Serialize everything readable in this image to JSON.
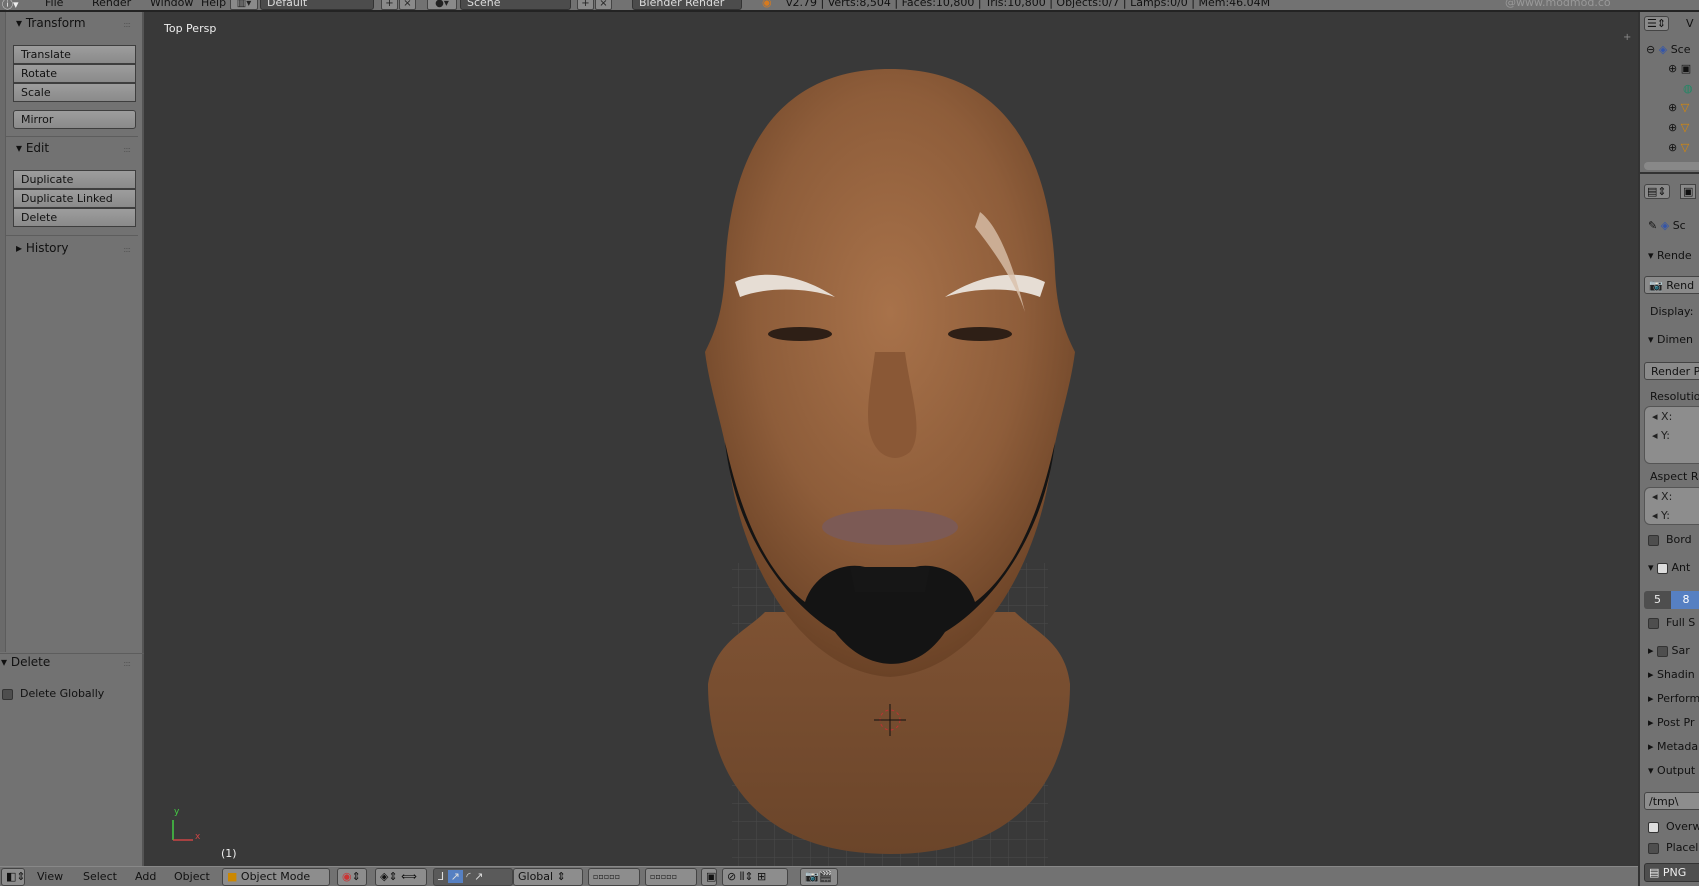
{
  "topbar": {
    "menus": [
      "File",
      "Render",
      "Window",
      "Help"
    ],
    "layout": "Default",
    "scene": "Scene",
    "engine": "Blender Render",
    "stats": "v2.79 | Verts:8,504 | Faces:10,800 | Tris:10,800 | Objects:0/7 | Lamps:0/0 | Mem:46.04M",
    "watermark": "@www.modmod.co"
  },
  "tools": {
    "transform": {
      "title": "Transform",
      "buttons": [
        "Translate",
        "Rotate",
        "Scale",
        "Mirror"
      ]
    },
    "edit": {
      "title": "Edit",
      "buttons": [
        "Duplicate",
        "Duplicate Linked",
        "Delete"
      ]
    },
    "history": {
      "title": "History"
    },
    "operator": {
      "title": "Delete",
      "option": "Delete Globally"
    }
  },
  "viewport": {
    "view_label": "Top Persp",
    "frame": "(1)",
    "axis_x": "x",
    "axis_y": "y"
  },
  "outliner": {
    "header": "V",
    "scene": "Sce"
  },
  "properties": {
    "context": "Sc",
    "render": "Rende",
    "render_btn": "Rend",
    "display": "Display:",
    "dimensions": "Dimen",
    "render_presets": "Render Pr",
    "resolution": "Resolutio",
    "x": "X:",
    "y": "Y:",
    "aspect": "Aspect Ra",
    "border": "Bord",
    "anti": "Ant",
    "aa_5": "5",
    "aa_8": "8",
    "full_sample": "Full S",
    "sampled": "Sar",
    "shading": "Shadin",
    "performance": "Perform",
    "post": "Post Pr",
    "metadata": "Metada",
    "output": "Output",
    "path": "/tmp\\",
    "overwrite": "Overw",
    "placeholders": "Placel",
    "format": "PNG"
  },
  "bottom": {
    "menus": [
      "View",
      "Select",
      "Add",
      "Object"
    ],
    "mode": "Object Mode",
    "orientation": "Global"
  },
  "colors": {
    "accent": "#5680c2",
    "viewport": "#393939",
    "panel": "#727272"
  }
}
